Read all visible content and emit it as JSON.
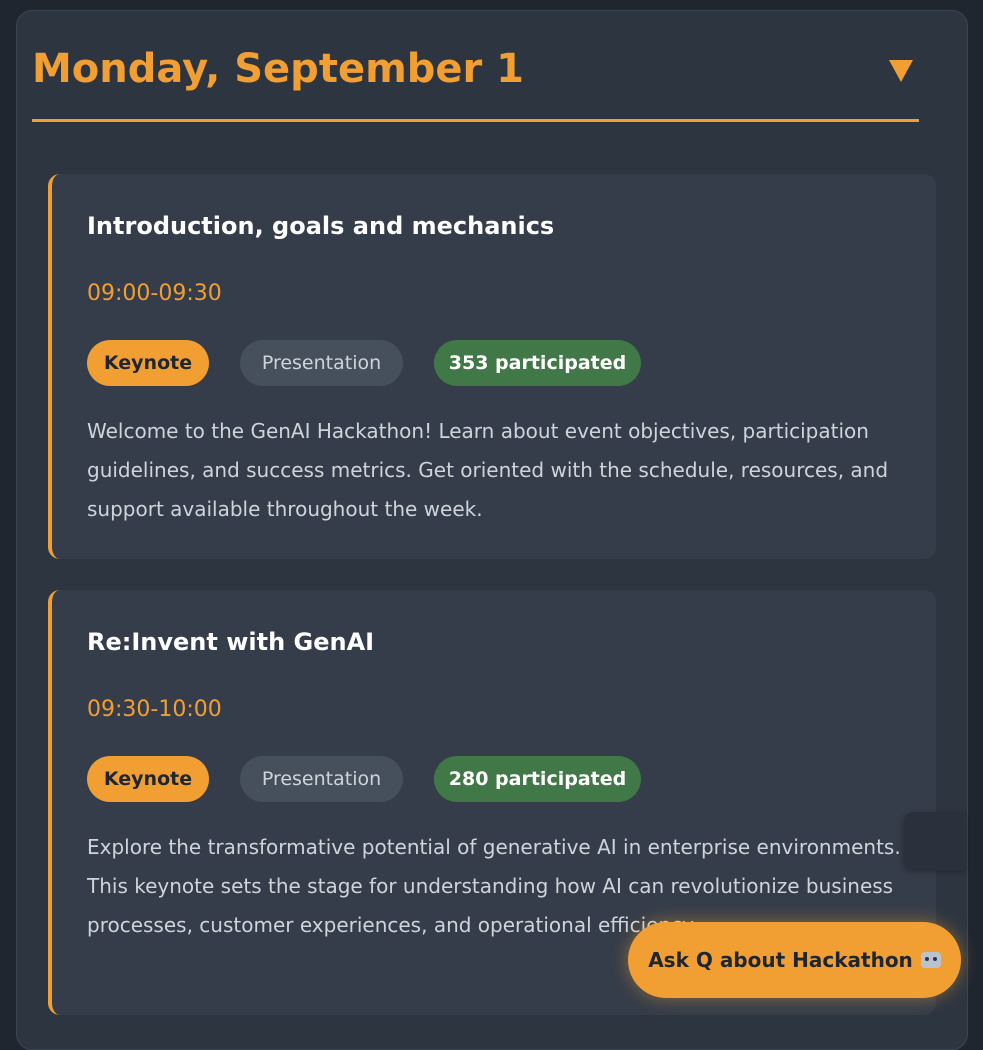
{
  "day": {
    "title": "Monday, September 1"
  },
  "sessions": [
    {
      "title": "Introduction, goals and mechanics",
      "time": "09:00-09:30",
      "category": "Keynote",
      "format": "Presentation",
      "participants": "353 participated",
      "description": "Welcome to the GenAI Hackathon! Learn about event objectives, participation guidelines, and success metrics. Get oriented with the schedule, resources, and support available throughout the week."
    },
    {
      "title": "Re:Invent with GenAI",
      "time": "09:30-10:00",
      "category": "Keynote",
      "format": "Presentation",
      "participants": "280 participated",
      "description": "Explore the transformative potential of generative AI in enterprise environments. This keynote sets the stage for understanding how AI can revolutionize business processes, customer experiences, and operational efficiency."
    }
  ],
  "assistant": {
    "label": "Ask Q about Hackathon",
    "icon": "robot-icon"
  },
  "colors": {
    "accent": "#f19f32",
    "participants_badge": "#417847",
    "card_bg": "#353d4a",
    "page_bg": "#1f2630"
  }
}
